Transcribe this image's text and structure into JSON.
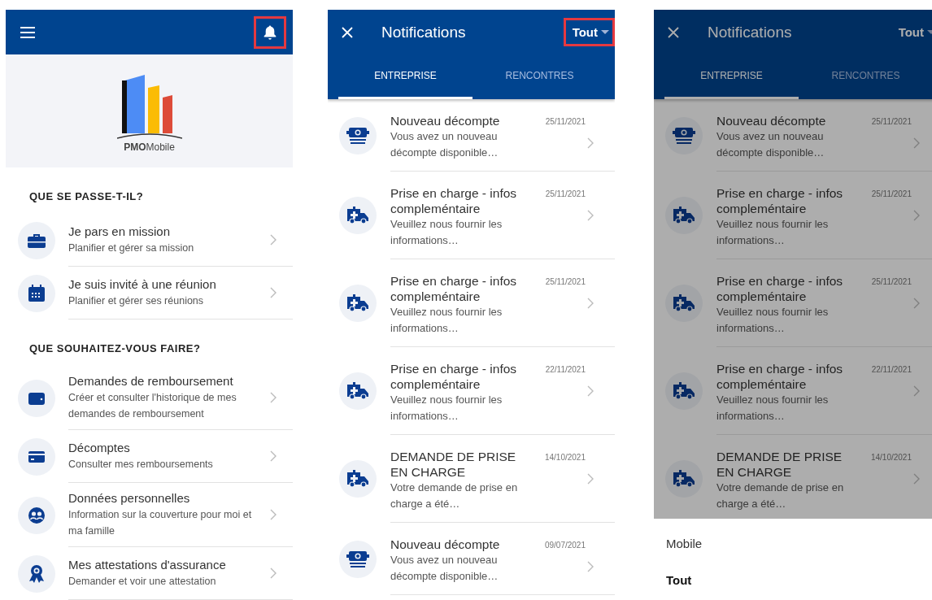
{
  "home_screen": {
    "bell_highlighted": true,
    "brand": "**PMO**Mobile",
    "sections": [
      {
        "heading": "QUE SE PASSE-T-IL?",
        "items": [
          {
            "kind": "briefcase",
            "title": "Je pars en mission",
            "subtitle": "Planifier et gérer sa mission"
          },
          {
            "kind": "calendar",
            "title": "Je suis invité à une réunion",
            "subtitle": "Planifier et gérer ses réunions"
          }
        ]
      },
      {
        "heading": "QUE SOUHAITEZ-VOUS FAIRE?",
        "items": [
          {
            "kind": "wallet",
            "title": "Demandes de remboursement",
            "subtitle": "Créer et consulter l'historique de mes demandes de remboursement"
          },
          {
            "kind": "card",
            "title": "Décomptes",
            "subtitle": "Consulter mes remboursements"
          },
          {
            "kind": "people",
            "title": "Données personnelles",
            "subtitle": "Information sur la couverture pour moi et ma famille"
          },
          {
            "kind": "award",
            "title": "Mes attestations d'assurance",
            "subtitle": "Demander et voir une attestation"
          }
        ]
      }
    ]
  },
  "notification_screens": [
    {
      "title": "Notifications",
      "filter": "Tout",
      "filter_highlighted": true,
      "dimmed": false,
      "tabs": [
        {
          "label": "ENTREPRISE",
          "selected": true
        },
        {
          "label": "RENCONTRES",
          "selected": false
        }
      ],
      "notifications": [
        {
          "kind": "statement",
          "title": "Nouveau décompte",
          "body": "Vous avez un nouveau décompte disponible…",
          "date": "25/11/2021"
        },
        {
          "kind": "coverage",
          "title": "Prise en charge - infos compleméntaire",
          "body": "Veuillez nous fournir les informations…",
          "date": "25/11/2021"
        },
        {
          "kind": "coverage",
          "title": "Prise en charge - infos compleméntaire",
          "body": "Veuillez nous fournir les informations…",
          "date": "25/11/2021"
        },
        {
          "kind": "coverage",
          "title": "Prise en charge - infos compleméntaire",
          "body": "Veuillez nous fournir les informations…",
          "date": "22/11/2021"
        },
        {
          "kind": "coverage",
          "title": "DEMANDE DE PRISE EN CHARGE",
          "body": "Votre demande de prise en charge a été…",
          "date": "14/10/2021"
        },
        {
          "kind": "statement",
          "title": "Nouveau décompte",
          "body": "Vous avez un nouveau décompte disponible…",
          "date": "09/07/2021"
        }
      ]
    },
    {
      "title": "Notifications",
      "filter": "Tout",
      "filter_highlighted": false,
      "dimmed": true,
      "tabs": [
        {
          "label": "ENTREPRISE",
          "selected": true
        },
        {
          "label": "RENCONTRES",
          "selected": false
        }
      ],
      "notifications": [
        {
          "kind": "statement",
          "title": "Nouveau décompte",
          "body": "Vous avez un nouveau décompte disponible…",
          "date": "25/11/2021"
        },
        {
          "kind": "coverage",
          "title": "Prise en charge - infos compleméntaire",
          "body": "Veuillez nous fournir les informations…",
          "date": "25/11/2021"
        },
        {
          "kind": "coverage",
          "title": "Prise en charge - infos compleméntaire",
          "body": "Veuillez nous fournir les informations…",
          "date": "25/11/2021"
        },
        {
          "kind": "coverage",
          "title": "Prise en charge - infos compleméntaire",
          "body": "Veuillez nous fournir les informations…",
          "date": "22/11/2021"
        },
        {
          "kind": "coverage",
          "title": "DEMANDE DE PRISE EN CHARGE",
          "body": "Votre demande de prise en charge a été…",
          "date": "14/10/2021"
        }
      ],
      "filter_menu": [
        {
          "label": "Mobile",
          "selected": false
        },
        {
          "label": "Tout",
          "selected": true
        }
      ]
    }
  ]
}
